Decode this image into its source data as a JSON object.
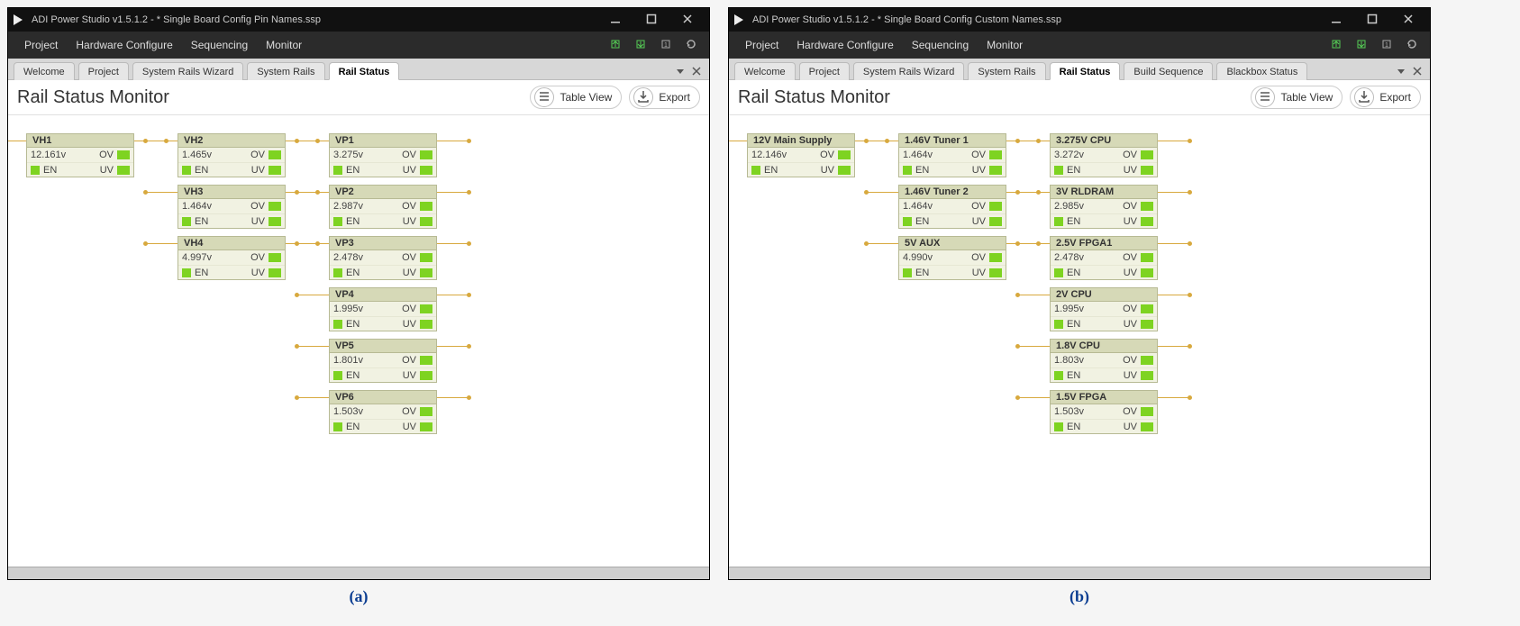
{
  "captions": {
    "a": "(a)",
    "b": "(b)"
  },
  "windows": [
    {
      "title": "ADI Power Studio v1.5.1.2 - * Single Board Config Pin Names.ssp",
      "menus": [
        "Project",
        "Hardware Configure",
        "Sequencing",
        "Monitor"
      ],
      "tabs": [
        "Welcome",
        "Project",
        "System Rails Wizard",
        "System Rails",
        "Rail Status"
      ],
      "active_tab": 4,
      "panel_title": "Rail Status Monitor",
      "buttons": {
        "table_view": "Table View",
        "export": "Export"
      },
      "tree": [
        {
          "name": "VH1",
          "voltage": "12.161v",
          "children": [
            {
              "name": "VH2",
              "voltage": "1.465v",
              "children": []
            },
            {
              "name": "VH3",
              "voltage": "1.464v",
              "children": []
            },
            {
              "name": "VH4",
              "voltage": "4.997v",
              "children": [
                {
                  "name": "VP1",
                  "voltage": "3.275v",
                  "children": []
                },
                {
                  "name": "VP2",
                  "voltage": "2.987v",
                  "children": []
                },
                {
                  "name": "VP3",
                  "voltage": "2.478v",
                  "children": []
                },
                {
                  "name": "VP4",
                  "voltage": "1.995v",
                  "children": []
                },
                {
                  "name": "VP5",
                  "voltage": "1.801v",
                  "children": []
                },
                {
                  "name": "VP6",
                  "voltage": "1.503v",
                  "children": []
                }
              ]
            }
          ]
        }
      ],
      "labels": {
        "en": "EN",
        "ov": "OV",
        "uv": "UV"
      }
    },
    {
      "title": "ADI Power Studio v1.5.1.2 - * Single Board Config Custom Names.ssp",
      "menus": [
        "Project",
        "Hardware Configure",
        "Sequencing",
        "Monitor"
      ],
      "tabs": [
        "Welcome",
        "Project",
        "System Rails Wizard",
        "System Rails",
        "Rail Status",
        "Build Sequence",
        "Blackbox Status"
      ],
      "active_tab": 4,
      "panel_title": "Rail Status Monitor",
      "buttons": {
        "table_view": "Table View",
        "export": "Export"
      },
      "tree": [
        {
          "name": "12V Main Supply",
          "voltage": "12.146v",
          "children": [
            {
              "name": "1.46V Tuner 1",
              "voltage": "1.464v",
              "children": []
            },
            {
              "name": "1.46V Tuner 2",
              "voltage": "1.464v",
              "children": []
            },
            {
              "name": "5V AUX",
              "voltage": "4.990v",
              "children": [
                {
                  "name": "3.275V CPU",
                  "voltage": "3.272v",
                  "children": []
                },
                {
                  "name": "3V RLDRAM",
                  "voltage": "2.985v",
                  "children": []
                },
                {
                  "name": "2.5V FPGA1",
                  "voltage": "2.478v",
                  "children": []
                },
                {
                  "name": "2V CPU",
                  "voltage": "1.995v",
                  "children": []
                },
                {
                  "name": "1.8V CPU",
                  "voltage": "1.803v",
                  "children": []
                },
                {
                  "name": "1.5V FPGA",
                  "voltage": "1.503v",
                  "children": []
                }
              ]
            }
          ]
        }
      ],
      "labels": {
        "en": "EN",
        "ov": "OV",
        "uv": "UV"
      }
    }
  ]
}
